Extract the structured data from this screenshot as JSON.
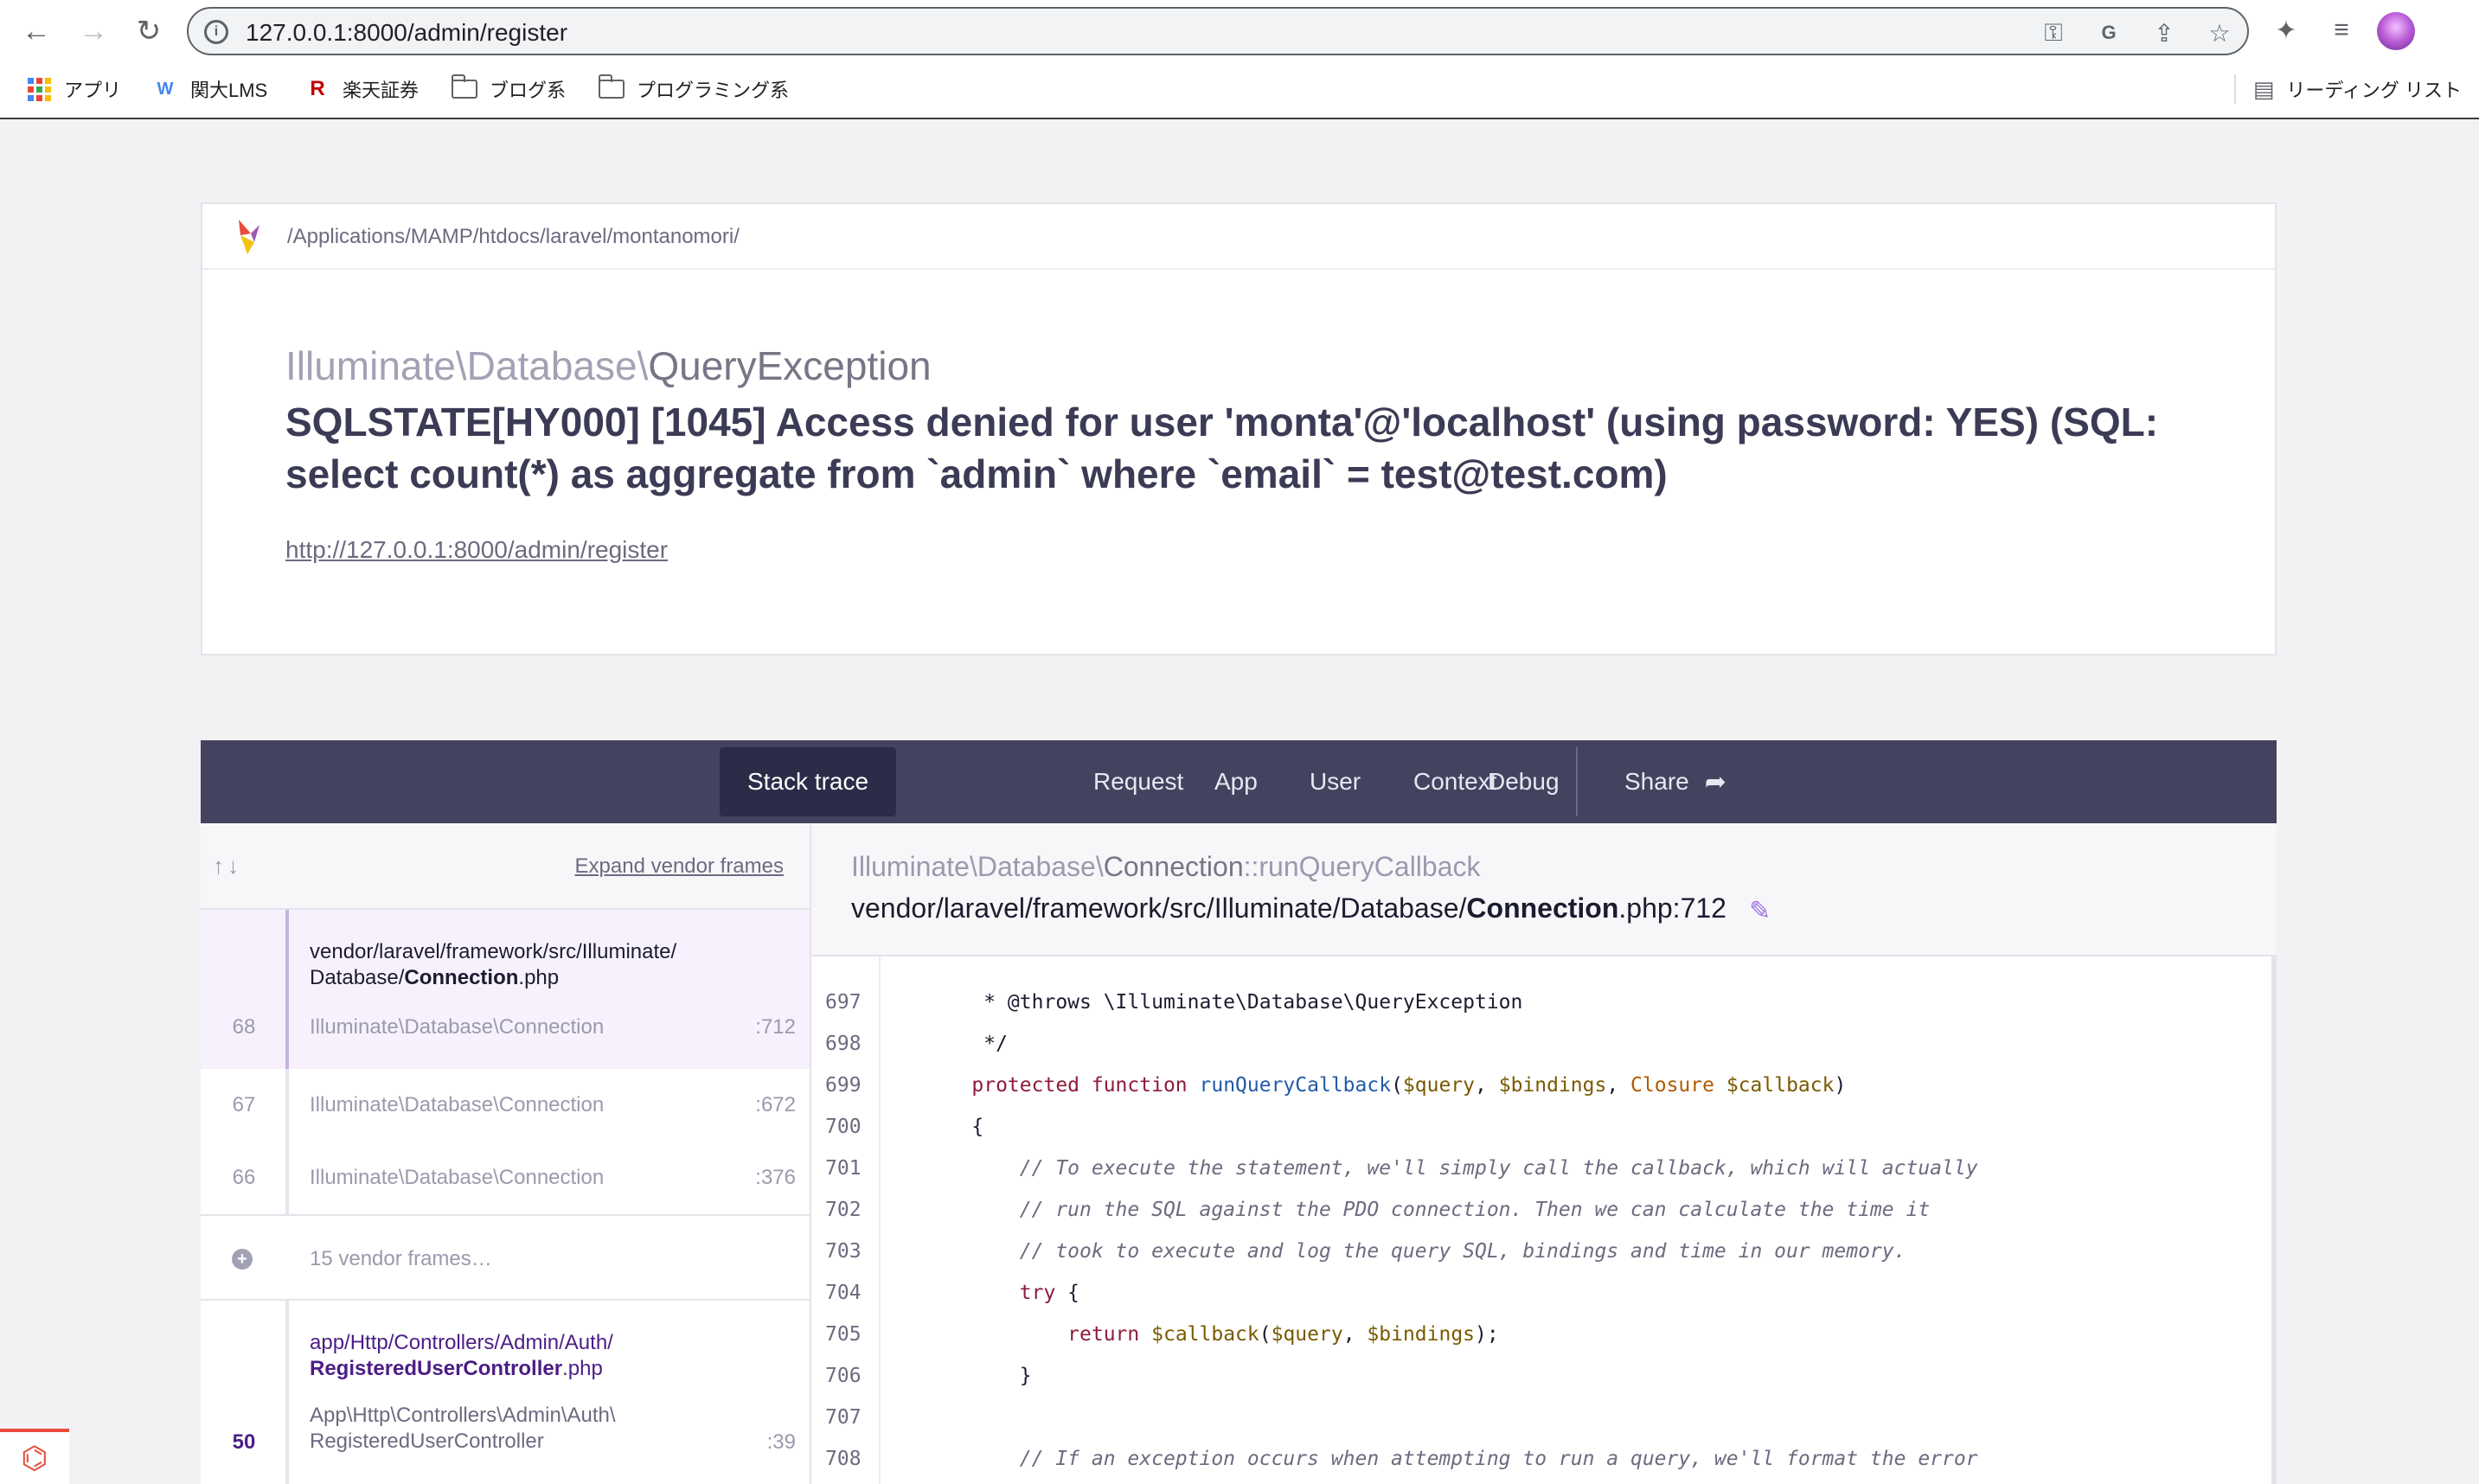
{
  "browser": {
    "url": "127.0.0.1:8000/admin/register",
    "bookmarks": [
      {
        "label": "アプリ",
        "icon": "apps-grid-icon"
      },
      {
        "label": "関大LMS",
        "icon": "lms-favicon"
      },
      {
        "label": "楽天証券",
        "icon": "rakuten-favicon"
      },
      {
        "label": "ブログ系",
        "icon": "folder-icon"
      },
      {
        "label": "プログラミング系",
        "icon": "folder-icon"
      }
    ],
    "reading_list": "リーディング リスト"
  },
  "header": {
    "path": "/Applications/MAMP/htdocs/laravel/montanomori/",
    "exception_namespace": "Illuminate\\Database\\",
    "exception_name": "QueryException",
    "message": "SQLSTATE[HY000] [1045] Access denied for user 'monta'@'localhost' (using password: YES) (SQL: select count(*) as aggregate from `admin` where `email` = test@test.com)",
    "url": "http://127.0.0.1:8000/admin/register"
  },
  "tabs": [
    "Stack trace",
    "Request",
    "App",
    "User",
    "Context",
    "Debug"
  ],
  "share_label": "Share",
  "frames_panel": {
    "expand_label": "Expand vendor frames",
    "frames": [
      {
        "num": "68",
        "file_prefix": "vendor/laravel/framework/src/Illuminate/",
        "file_dir2": "Database/",
        "file_name": "Connection",
        "file_ext": ".php",
        "class": "Illuminate\\Database\\Connection",
        "line": ":712"
      },
      {
        "num": "67",
        "class": "Illuminate\\Database\\Connection",
        "line": ":672"
      },
      {
        "num": "66",
        "class": "Illuminate\\Database\\Connection",
        "line": ":376"
      }
    ],
    "vendor_frames_label": "15 vendor frames…",
    "app_frame": {
      "num": "50",
      "file_prefix": "app/Http/Controllers/Admin/Auth/",
      "file_name": "RegisteredUserController",
      "file_ext": ".php",
      "class_line1": "App\\Http\\Controllers\\Admin\\Auth\\",
      "class_line2": "RegisteredUserController",
      "line": ":39"
    }
  },
  "code_panel": {
    "fn_namespace": "Illuminate\\Database\\",
    "fn_class": "Connection",
    "fn_method": "::runQueryCallback",
    "path_prefix": "vendor/laravel/framework/src/Illuminate/Database/",
    "path_file": "Connection",
    "path_suffix": ".php:712",
    "line_numbers": [
      "697",
      "698",
      "699",
      "700",
      "701",
      "702",
      "703",
      "704",
      "705",
      "706",
      "707",
      "708"
    ]
  },
  "colors": {
    "tabbar": "#43435f",
    "active_tab": "#2c2c48",
    "accent_purple": "#4c1d86",
    "laravel_red": "#e74c3c"
  }
}
